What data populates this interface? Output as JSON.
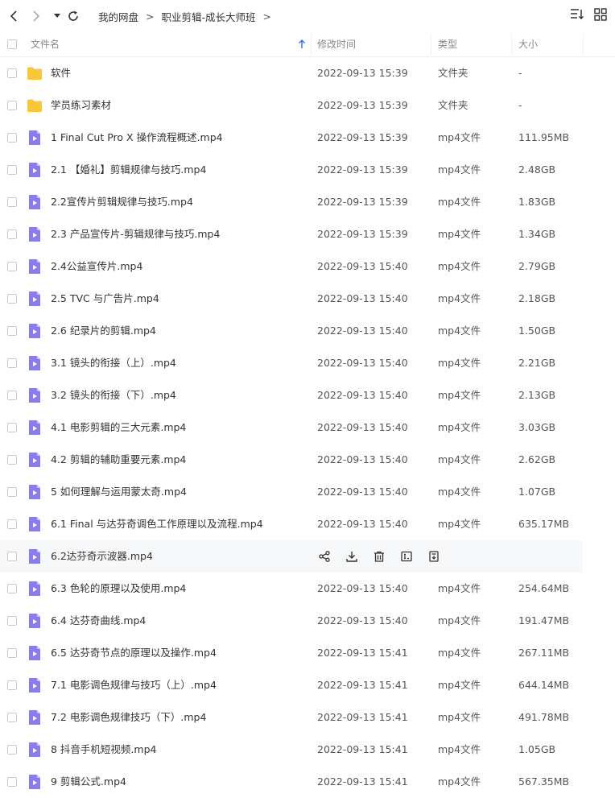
{
  "toolbar": {
    "breadcrumb": [
      "我的网盘",
      "职业剪辑-成长大师班"
    ],
    "separator": ">"
  },
  "columns": {
    "name": "文件名",
    "modified": "修改时间",
    "type": "类型",
    "size": "大小"
  },
  "colors": {
    "folder": "#f9c83a",
    "video_icon": "#8b7bf0",
    "hover_row": "#f7f8fa",
    "sort_arrow": "#2f7cf6"
  },
  "files": [
    {
      "name": "软件",
      "time": "2022-09-13 15:39",
      "type": "文件夹",
      "size": "-",
      "icon": "folder-icon"
    },
    {
      "name": "学员练习素材",
      "time": "2022-09-13 15:39",
      "type": "文件夹",
      "size": "-",
      "icon": "folder-icon"
    },
    {
      "name": "1 Final Cut Pro X 操作流程概述.mp4",
      "time": "2022-09-13 15:39",
      "type": "mp4文件",
      "size": "111.95MB",
      "icon": "video-file-icon"
    },
    {
      "name": "2.1 【婚礼】剪辑规律与技巧.mp4",
      "time": "2022-09-13 15:39",
      "type": "mp4文件",
      "size": "2.48GB",
      "icon": "video-file-icon"
    },
    {
      "name": "2.2宣传片剪辑规律与技巧.mp4",
      "time": "2022-09-13 15:39",
      "type": "mp4文件",
      "size": "1.83GB",
      "icon": "video-file-icon"
    },
    {
      "name": "2.3 产品宣传片-剪辑规律与技巧.mp4",
      "time": "2022-09-13 15:39",
      "type": "mp4文件",
      "size": "1.34GB",
      "icon": "video-file-icon"
    },
    {
      "name": "2.4公益宣传片.mp4",
      "time": "2022-09-13 15:40",
      "type": "mp4文件",
      "size": "2.79GB",
      "icon": "video-file-icon"
    },
    {
      "name": "2.5 TVC 与广告片.mp4",
      "time": "2022-09-13 15:40",
      "type": "mp4文件",
      "size": "2.18GB",
      "icon": "video-file-icon"
    },
    {
      "name": "2.6 纪录片的剪辑.mp4",
      "time": "2022-09-13 15:40",
      "type": "mp4文件",
      "size": "1.50GB",
      "icon": "video-file-icon"
    },
    {
      "name": "3.1 镜头的衔接（上）.mp4",
      "time": "2022-09-13 15:40",
      "type": "mp4文件",
      "size": "2.21GB",
      "icon": "video-file-icon"
    },
    {
      "name": "3.2 镜头的衔接（下）.mp4",
      "time": "2022-09-13 15:40",
      "type": "mp4文件",
      "size": "2.13GB",
      "icon": "video-file-icon"
    },
    {
      "name": "4.1 电影剪辑的三大元素.mp4",
      "time": "2022-09-13 15:40",
      "type": "mp4文件",
      "size": "3.03GB",
      "icon": "video-file-icon"
    },
    {
      "name": "4.2 剪辑的辅助重要元素.mp4",
      "time": "2022-09-13 15:40",
      "type": "mp4文件",
      "size": "2.62GB",
      "icon": "video-file-icon"
    },
    {
      "name": "5 如何理解与运用蒙太奇.mp4",
      "time": "2022-09-13 15:40",
      "type": "mp4文件",
      "size": "1.07GB",
      "icon": "video-file-icon"
    },
    {
      "name": "6.1 Final 与达芬奇调色工作原理以及流程.mp4",
      "time": "2022-09-13 15:40",
      "type": "mp4文件",
      "size": "635.17MB",
      "icon": "video-file-icon"
    },
    {
      "name": "6.2达芬奇示波器.mp4",
      "time": "",
      "type": "",
      "size": "",
      "icon": "video-file-icon",
      "hovered": true
    },
    {
      "name": "6.3 色轮的原理以及使用.mp4",
      "time": "2022-09-13 15:40",
      "type": "mp4文件",
      "size": "254.64MB",
      "icon": "video-file-icon"
    },
    {
      "name": "6.4 达芬奇曲线.mp4",
      "time": "2022-09-13 15:40",
      "type": "mp4文件",
      "size": "191.47MB",
      "icon": "video-file-icon"
    },
    {
      "name": "6.5 达芬奇节点的原理以及操作.mp4",
      "time": "2022-09-13 15:41",
      "type": "mp4文件",
      "size": "267.11MB",
      "icon": "video-file-icon"
    },
    {
      "name": "7.1 电影调色规律与技巧（上）.mp4",
      "time": "2022-09-13 15:41",
      "type": "mp4文件",
      "size": "644.14MB",
      "icon": "video-file-icon"
    },
    {
      "name": "7.2 电影调色规律技巧（下）.mp4",
      "time": "2022-09-13 15:41",
      "type": "mp4文件",
      "size": "491.78MB",
      "icon": "video-file-icon"
    },
    {
      "name": "8 抖音手机短视频.mp4",
      "time": "2022-09-13 15:41",
      "type": "mp4文件",
      "size": "1.05GB",
      "icon": "video-file-icon"
    },
    {
      "name": "9 剪辑公式.mp4",
      "time": "2022-09-13 15:41",
      "type": "mp4文件",
      "size": "567.35MB",
      "icon": "video-file-icon"
    }
  ],
  "hover_actions": [
    "share-icon",
    "download-icon",
    "delete-icon",
    "rename-icon",
    "more-icon"
  ]
}
